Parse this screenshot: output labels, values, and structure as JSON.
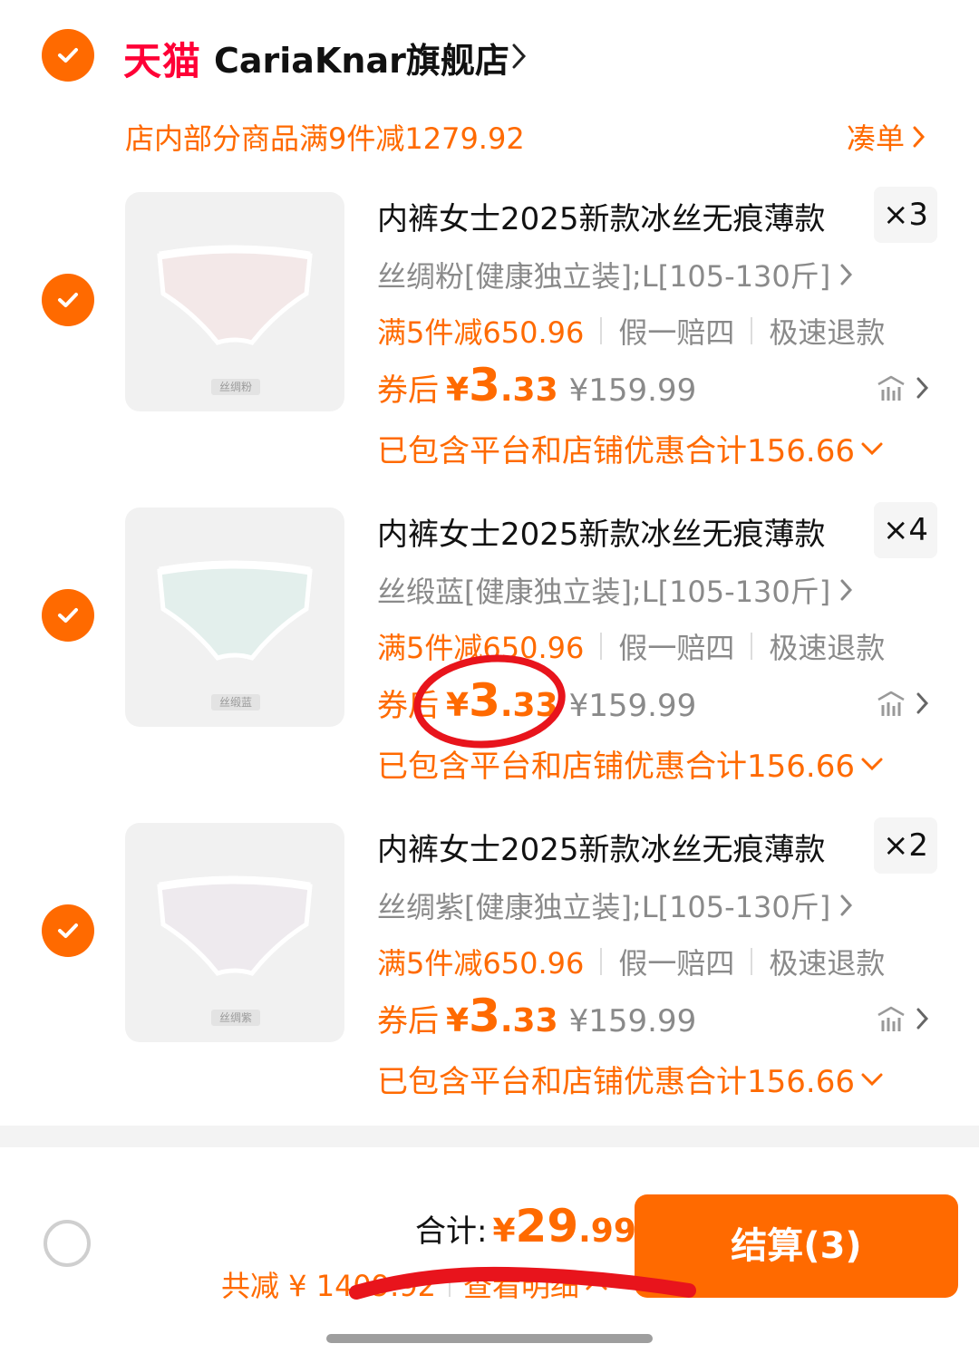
{
  "shop": {
    "brand": "天猫",
    "name": "CariaKnar旗舰店",
    "promo": "店内部分商品满9件减1279.92",
    "coudan": "凑单"
  },
  "items": [
    {
      "title": "内裤女士2025新款冰丝无痕薄款",
      "qty": "×3",
      "sku": "丝绸粉[健康独立装];L[105-130斤]",
      "promo_tag": "满5件减650.96",
      "service1": "假一赔四",
      "service2": "极速退款",
      "price_label": "券后",
      "price_yen": "¥",
      "price_int": "3",
      "price_dec": ".33",
      "orig_price": "¥159.99",
      "included": "已包含平台和店铺优惠合计156.66",
      "img_tag": "丝绸粉",
      "color": "#f3e8e8"
    },
    {
      "title": "内裤女士2025新款冰丝无痕薄款",
      "qty": "×4",
      "sku": "丝缎蓝[健康独立装];L[105-130斤]",
      "promo_tag": "满5件减650.96",
      "service1": "假一赔四",
      "service2": "极速退款",
      "price_label": "券后",
      "price_yen": "¥",
      "price_int": "3",
      "price_dec": ".33",
      "orig_price": "¥159.99",
      "included": "已包含平台和店铺优惠合计156.66",
      "img_tag": "丝缎蓝",
      "color": "#e3efec"
    },
    {
      "title": "内裤女士2025新款冰丝无痕薄款",
      "qty": "×2",
      "sku": "丝绸紫[健康独立装];L[105-130斤]",
      "promo_tag": "满5件减650.96",
      "service1": "假一赔四",
      "service2": "极速退款",
      "price_label": "券后",
      "price_yen": "¥",
      "price_int": "3",
      "price_dec": ".33",
      "orig_price": "¥159.99",
      "included": "已包含平台和店铺优惠合计156.66",
      "img_tag": "丝绸紫",
      "color": "#eeeaee"
    }
  ],
  "footer": {
    "total_label": "合计:",
    "total_yen": "¥",
    "total_int": "29",
    "total_dec": ".99",
    "saved": "共减 ¥ 1409.92",
    "detail": "查看明细",
    "checkout": "结算(3)"
  },
  "colors": {
    "accent": "#ff6a00",
    "tmall_red": "#ff0036",
    "annotation_red": "#e8141c"
  },
  "icons": {
    "check": "checkmark-icon",
    "chevron": "chevron-right-icon",
    "chevron_down": "chevron-down-icon",
    "chevron_up": "chevron-up-icon",
    "price_trend": "price-trend-icon"
  }
}
